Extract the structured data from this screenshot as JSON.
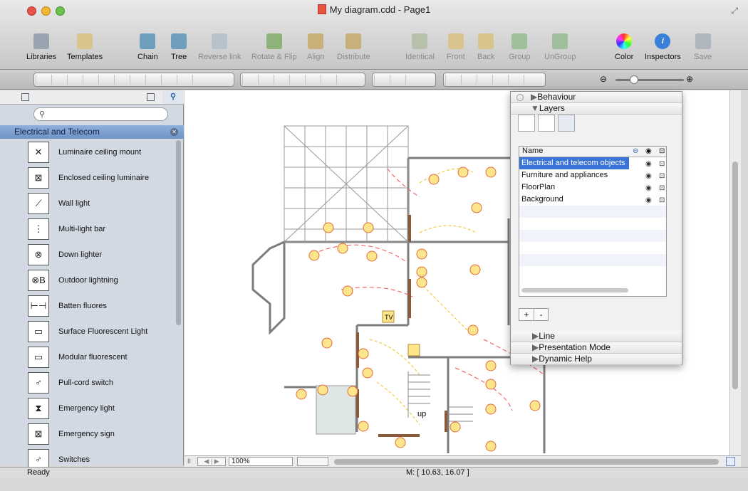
{
  "window": {
    "title": "My diagram.cdd - Page1"
  },
  "toolbar": {
    "items": [
      {
        "label": "Libraries",
        "enabled": true
      },
      {
        "label": "Templates",
        "enabled": true
      },
      {
        "label": "Chain",
        "enabled": true
      },
      {
        "label": "Tree",
        "enabled": true
      },
      {
        "label": "Reverse link",
        "enabled": false
      },
      {
        "label": "Rotate & Flip",
        "enabled": false
      },
      {
        "label": "Align",
        "enabled": false
      },
      {
        "label": "Distribute",
        "enabled": false
      },
      {
        "label": "Identical",
        "enabled": false
      },
      {
        "label": "Front",
        "enabled": false
      },
      {
        "label": "Back",
        "enabled": false
      },
      {
        "label": "Group",
        "enabled": false
      },
      {
        "label": "UnGroup",
        "enabled": false
      },
      {
        "label": "Color",
        "enabled": true
      },
      {
        "label": "Inspectors",
        "enabled": true
      },
      {
        "label": "Save",
        "enabled": false
      }
    ]
  },
  "library": {
    "search_placeholder": "",
    "title": "Electrical and Telecom",
    "shapes": [
      {
        "label": "Luminaire ceiling mount",
        "glyph": "✕"
      },
      {
        "label": "Enclosed ceiling luminaire",
        "glyph": "⊠"
      },
      {
        "label": "Wall light",
        "glyph": "⟋"
      },
      {
        "label": "Multi-light bar",
        "glyph": "⋮"
      },
      {
        "label": "Down lighter",
        "glyph": "⊗"
      },
      {
        "label": "Outdoor lightning",
        "glyph": "⊗B"
      },
      {
        "label": "Batten fluores",
        "glyph": "⊢⊣"
      },
      {
        "label": "Surface Fluorescent Light",
        "glyph": "▭"
      },
      {
        "label": "Modular fluorescent",
        "glyph": "▭"
      },
      {
        "label": "Pull-cord switch",
        "glyph": "♂"
      },
      {
        "label": "Emergency light",
        "glyph": "⧗"
      },
      {
        "label": "Emergency sign",
        "glyph": "⊠"
      },
      {
        "label": "Switches",
        "glyph": "♂"
      }
    ]
  },
  "panel": {
    "sections": {
      "behaviour": "Behaviour",
      "layers": "Layers",
      "line": "Line",
      "presentation": "Presentation Mode",
      "help": "Dynamic Help"
    },
    "layers_header": "Name",
    "layers": [
      {
        "name": "Electrical and telecom objects",
        "selected": true
      },
      {
        "name": "Furniture and appliances",
        "selected": false
      },
      {
        "name": "FloorPlan",
        "selected": false
      },
      {
        "name": "Background",
        "selected": false
      }
    ],
    "add_label": "+",
    "remove_label": "-"
  },
  "canvas": {
    "labels": {
      "tv": "TV",
      "up": "up"
    }
  },
  "zoom": {
    "value": "100%"
  },
  "status": {
    "ready": "Ready",
    "coords": "M: [ 10.63, 16.07 ]"
  }
}
